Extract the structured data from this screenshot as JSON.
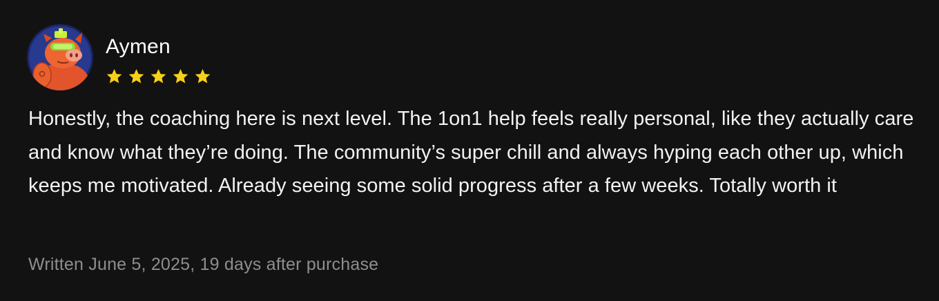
{
  "review": {
    "reviewer_name": "Aymen",
    "avatar_icon": "pig-avatar-icon",
    "rating": 5,
    "rating_max": 5,
    "star_color": "#f7d117",
    "text": "Honestly, the coaching here is next level. The 1on1 help feels really personal, like they actually care and know what they’re doing. The community’s super chill and always hyping each other up, which keeps me motivated. Already seeing some solid progress after a few weeks. Totally worth it",
    "meta": "Written June 5, 2025, 19 days after purchase"
  },
  "colors": {
    "background": "#121212",
    "text": "#f2f2f2",
    "muted": "#8e8e8e",
    "avatar_ring": "#1f2a6b",
    "avatar_bg": "#263580",
    "pig": "#e8532b"
  }
}
